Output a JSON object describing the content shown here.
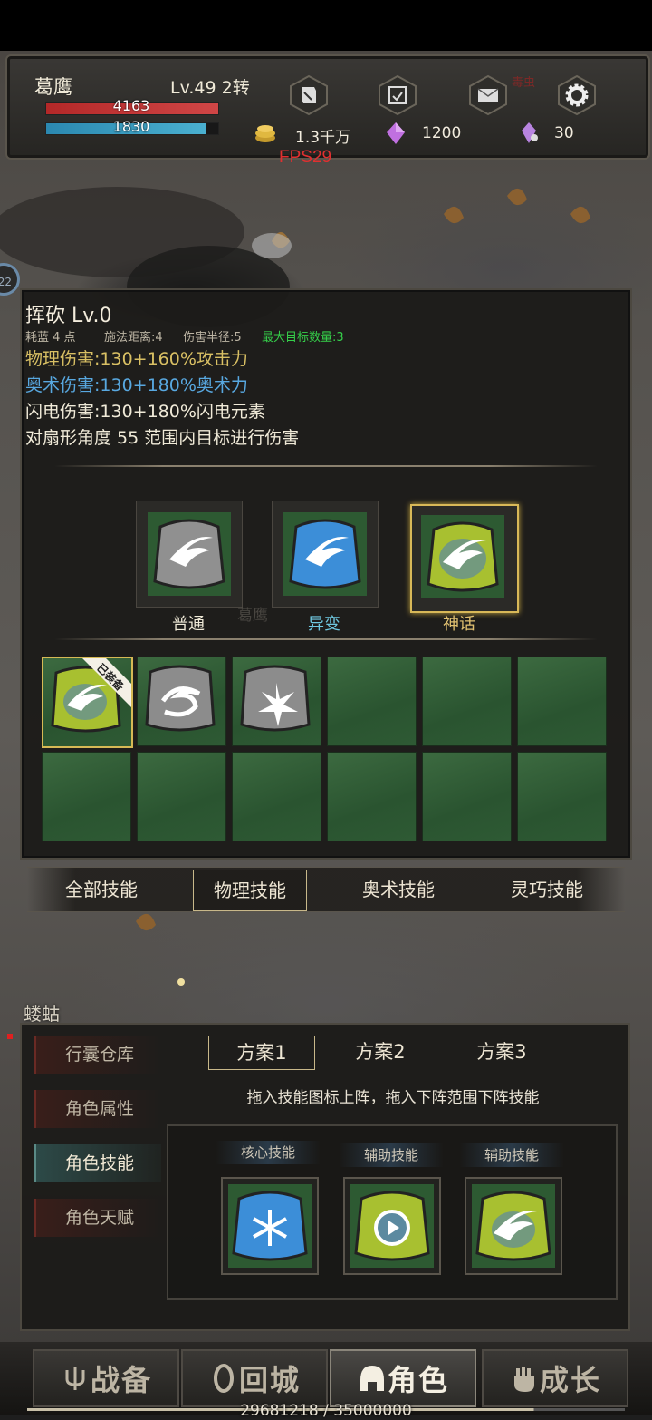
{
  "player": {
    "name": "葛鹰",
    "level": "Lv.49 2转",
    "hp": "4163",
    "mp": "1830"
  },
  "currency": {
    "gold": "1.3千万",
    "gems": "1200",
    "crystals": "30"
  },
  "fps": "FPS29",
  "header_icons": [
    "quest-scroll-icon",
    "calendar-check-icon",
    "mail-icon",
    "settings-gear-icon"
  ],
  "monster_name_faint": "毒虫",
  "side_marker": "22",
  "skill": {
    "title": "挥砍 Lv.0",
    "stats": {
      "mana": "耗蓝 4 点",
      "range": "施法距离:4",
      "radius": "伤害半径:5",
      "max_targets": "最大目标数量:3"
    },
    "physical": "物理伤害:130+160%攻击力",
    "arcane": "奥术伤害:130+180%奥术力",
    "lightning": "闪电伤害:130+180%闪电元素",
    "desc": "对扇形角度 55 范围内目标进行伤害"
  },
  "tiers": [
    {
      "label": "普通",
      "color": "#f0ead8"
    },
    {
      "label": "异变",
      "color": "#6fc8e0"
    },
    {
      "label": "神话",
      "color": "#e0c070"
    }
  ],
  "equipped_tag": "已装备",
  "watermark_name": "葛鹰",
  "skill_tabs": [
    "全部技能",
    "物理技能",
    "奥术技能",
    "灵巧技能"
  ],
  "active_skill_tab": "物理技能",
  "enemy_label": "蝼蛄",
  "side_menu": [
    "行囊仓库",
    "角色属性",
    "角色技能",
    "角色天赋"
  ],
  "plans": [
    "方案1",
    "方案2",
    "方案3"
  ],
  "hint": "拖入技能图标上阵，拖入下阵范围下阵技能",
  "slots": [
    "核心技能",
    "辅助技能",
    "辅助技能"
  ],
  "nav": [
    "战备",
    "回城",
    "角色",
    "成长"
  ],
  "exp": "29681218 / 35000000",
  "exp_progress": 0.848
}
